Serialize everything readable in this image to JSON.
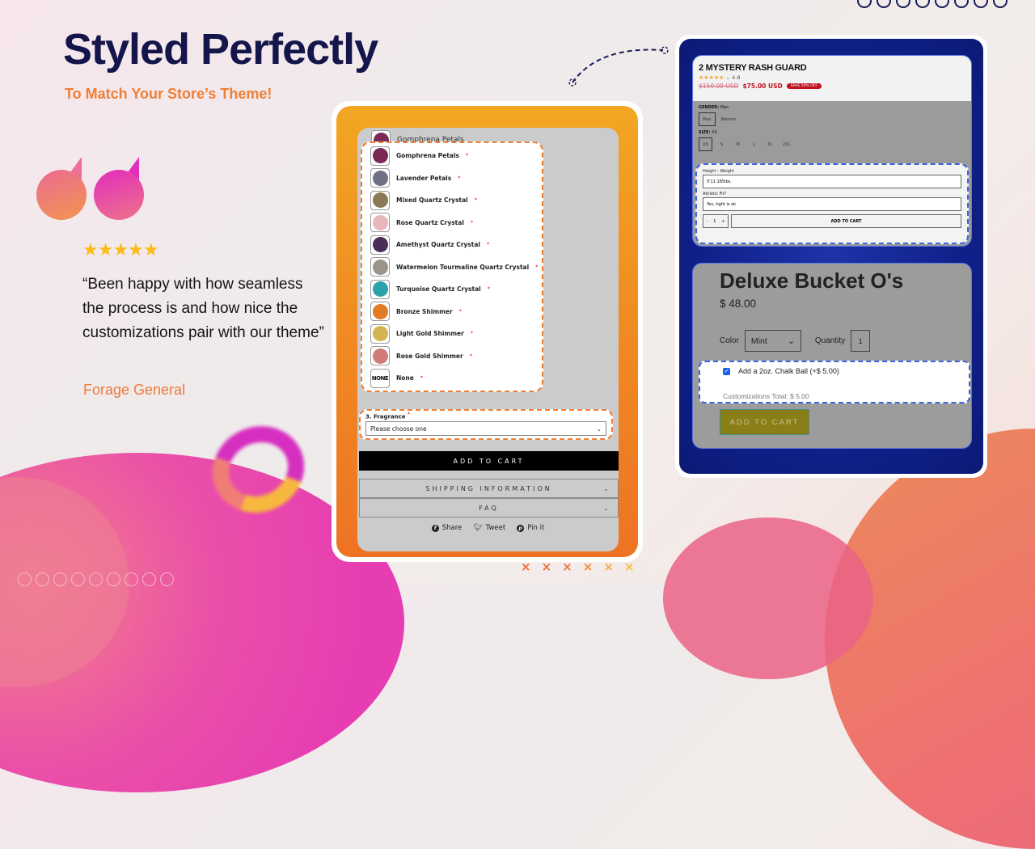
{
  "header": {
    "title": "Styled Perfectly",
    "subtitle": "To Match Your Store’s Theme!"
  },
  "testimonial": {
    "rating_stars": 5,
    "stars_text": "★★★★★",
    "quote": "“Been happy with how seamless the process is and how nice the customizations pair with our theme”",
    "author": "Forage General"
  },
  "decor": {
    "x_marks": [
      "×",
      "×",
      "×",
      "×",
      "×",
      "×"
    ],
    "colors": {
      "title": "#14154a",
      "accent": "#ef7f35",
      "dashed_orange": "#ef7e35",
      "dashed_blue": "#3c63e0"
    }
  },
  "left_store": {
    "partial_option_label": "Gomphrena Petals",
    "options": [
      {
        "label": "Gomphrena Petals",
        "swatch": "#7a2a55"
      },
      {
        "label": "Lavender Petals",
        "swatch": "#6f6f86"
      },
      {
        "label": "Mixed Quartz Crystal",
        "swatch": "#8a7a55"
      },
      {
        "label": "Rose Quartz Crystal",
        "swatch": "#e8b7bb"
      },
      {
        "label": "Amethyst Quartz Crystal",
        "swatch": "#4a2e57"
      },
      {
        "label": "Watermelon Tourmaline Quartz Crystal",
        "swatch": "#9b948c"
      },
      {
        "label": "Turquoise Quartz Crystal",
        "swatch": "#2aa3aa"
      },
      {
        "label": "Bronze Shimmer",
        "swatch": "#e07a24"
      },
      {
        "label": "Light Gold Shimmer",
        "swatch": "#d3b450"
      },
      {
        "label": "Rose Gold Shimmer",
        "swatch": "#cf7b78"
      },
      {
        "label": "None",
        "swatch": "NONE"
      }
    ],
    "required_mark": "*",
    "fragrance_label": "3. Fragrance",
    "fragrance_placeholder": "Please choose one",
    "add_to_cart": "ADD TO CART",
    "accordions": [
      "SHIPPING INFORMATION",
      "FAQ"
    ],
    "social": {
      "share": "Share",
      "tweet": "Tweet",
      "pin": "Pin it"
    }
  },
  "right_store_1": {
    "title": "2 MYSTERY RASH GUARD",
    "rating": "4.8",
    "stars_text": "★★★★★",
    "price_original": "$150.00 USD",
    "price_sale": "$75.00 USD",
    "badge": "SAVE 50% OFF",
    "gender_label": "GENDER:",
    "gender_value": "Man",
    "gender_options": [
      "Man",
      "Women"
    ],
    "size_label": "SIZE:",
    "size_value": "XS",
    "size_options": [
      "XS",
      "S",
      "M",
      "L",
      "XL",
      "2XL"
    ],
    "field1_label": "Height - Weight",
    "field1_value": "5'11 165lbs.",
    "field2_label": "Athletic Fit?",
    "field2_value": "Yes, tight is ok",
    "qty_minus": "-",
    "qty_value": "1",
    "qty_plus": "+",
    "add_to_cart": "ADD TO CART"
  },
  "right_store_2": {
    "title": "Deluxe Bucket O's",
    "price": "$ 48.00",
    "color_label": "Color",
    "color_value": "Mint",
    "quantity_label": "Quantity",
    "quantity_value": "1",
    "addon_label": "Add a 2oz. Chalk Ball (+$ 5.00)",
    "addon_checked": true,
    "customizations_total": "Customizations Total: $ 5.00",
    "add_to_cart": "ADD TO CART"
  }
}
